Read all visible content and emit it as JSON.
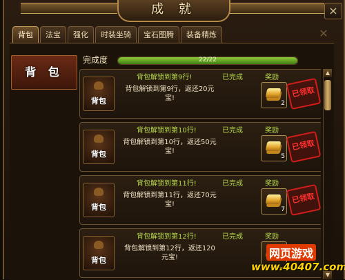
{
  "window": {
    "title": "成 就",
    "close_icon": "×"
  },
  "tabs": [
    {
      "label": "背包",
      "active": true
    },
    {
      "label": "法宝"
    },
    {
      "label": "强化"
    },
    {
      "label": "时装坐骑"
    },
    {
      "label": "宝石图腾"
    },
    {
      "label": "装备精炼"
    }
  ],
  "sidebar": {
    "active_label": "背 包"
  },
  "progress": {
    "label": "完成度",
    "text": "22/22",
    "fraction": 1.0
  },
  "column_labels": {
    "status": "已完成",
    "reward": "奖励"
  },
  "achievements": [
    {
      "title": "背包解锁到第9行!",
      "desc": "背包解锁到第9行，返还20元宝!",
      "reward_count": "2",
      "stamp": "已领取",
      "icon_label": "背包"
    },
    {
      "title": "背包解锁到第10行!",
      "desc": "背包解锁到第10行，返还50元宝!",
      "reward_count": "5",
      "stamp": "已领取",
      "icon_label": "背包"
    },
    {
      "title": "背包解锁到第11行!",
      "desc": "背包解锁到第11行，返还70元宝!",
      "reward_count": "7",
      "stamp": "已领取",
      "icon_label": "背包"
    },
    {
      "title": "背包解锁到第12行!",
      "desc": "背包解锁到第12行，返还120元宝!",
      "reward_count": "",
      "stamp": "",
      "icon_label": "背包"
    }
  ],
  "watermark": {
    "top": "网页游戏",
    "bottom": "www.40407.com"
  },
  "colors": {
    "progress_fill": "#5fa320",
    "stamp_red": "#d11c1c",
    "accent_green": "#b6d94c"
  }
}
